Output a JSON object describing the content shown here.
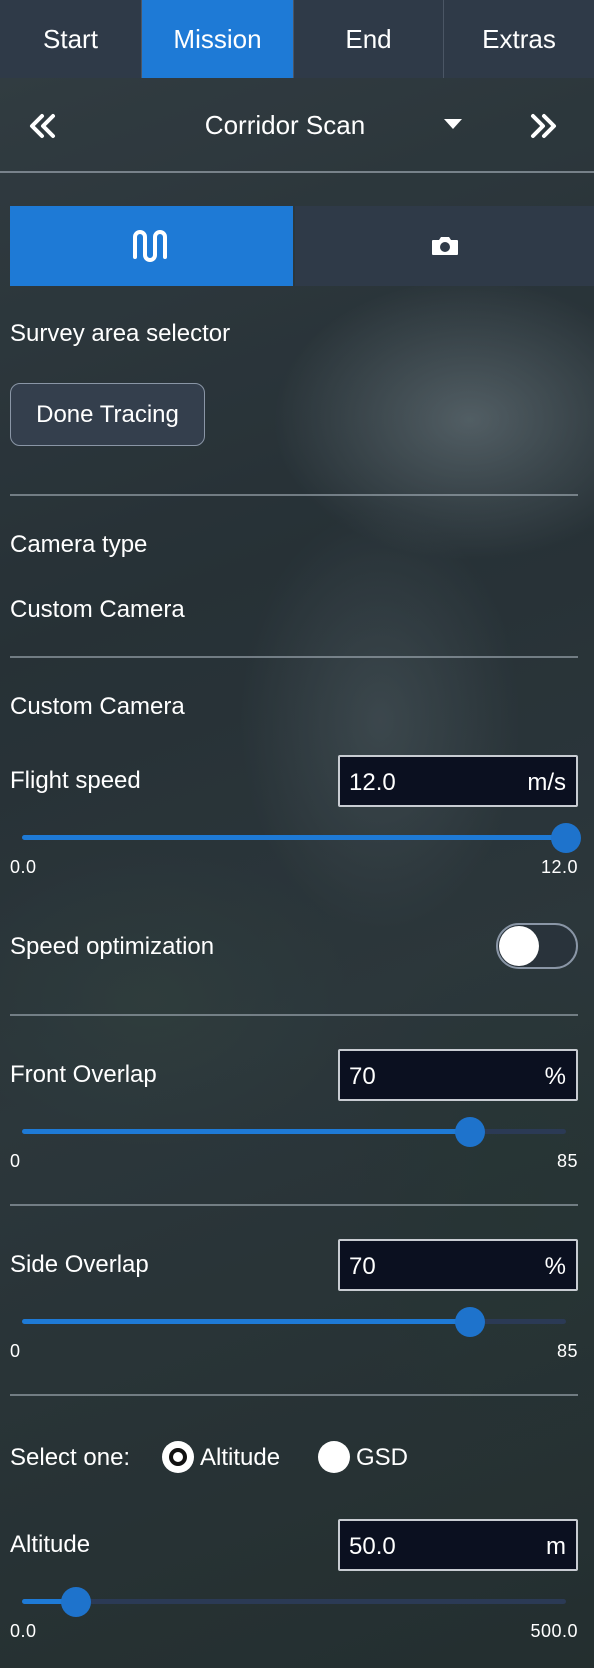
{
  "tabs": [
    {
      "label": "Start",
      "active": false
    },
    {
      "label": "Mission",
      "active": true
    },
    {
      "label": "End",
      "active": false
    },
    {
      "label": "Extras",
      "active": false
    }
  ],
  "mission": {
    "title": "Corridor Scan",
    "prev_icon": "double-chevron-left-icon",
    "next_icon": "double-chevron-right-icon"
  },
  "modes": [
    {
      "icon": "flight-path-icon",
      "active": true
    },
    {
      "icon": "camera-icon",
      "active": false
    }
  ],
  "survey": {
    "label": "Survey area selector",
    "done_label": "Done Tracing"
  },
  "camera": {
    "type_label": "Camera type",
    "type_value": "Custom Camera",
    "name": "Custom Camera"
  },
  "flight_speed": {
    "label": "Flight speed",
    "value": "12.0",
    "unit": "m/s",
    "min": "0.0",
    "max": "12.0",
    "fraction": 1.0
  },
  "speed_optimization": {
    "label": "Speed optimization",
    "enabled": false
  },
  "front_overlap": {
    "label": "Front Overlap",
    "value": "70",
    "unit": "%",
    "min": "0",
    "max": "85",
    "fraction": 0.8235
  },
  "side_overlap": {
    "label": "Side Overlap",
    "value": "70",
    "unit": "%",
    "min": "0",
    "max": "85",
    "fraction": 0.8235
  },
  "select_mode": {
    "label": "Select one:",
    "options": [
      {
        "label": "Altitude",
        "selected": true
      },
      {
        "label": "GSD",
        "selected": false
      }
    ]
  },
  "altitude": {
    "label": "Altitude",
    "value": "50.0",
    "unit": "m",
    "min": "0.0",
    "max": "500.0",
    "fraction": 0.1
  },
  "colors": {
    "accent": "#1e7ad6",
    "panel": "#2f3a48",
    "field_bg": "#0b1020"
  }
}
